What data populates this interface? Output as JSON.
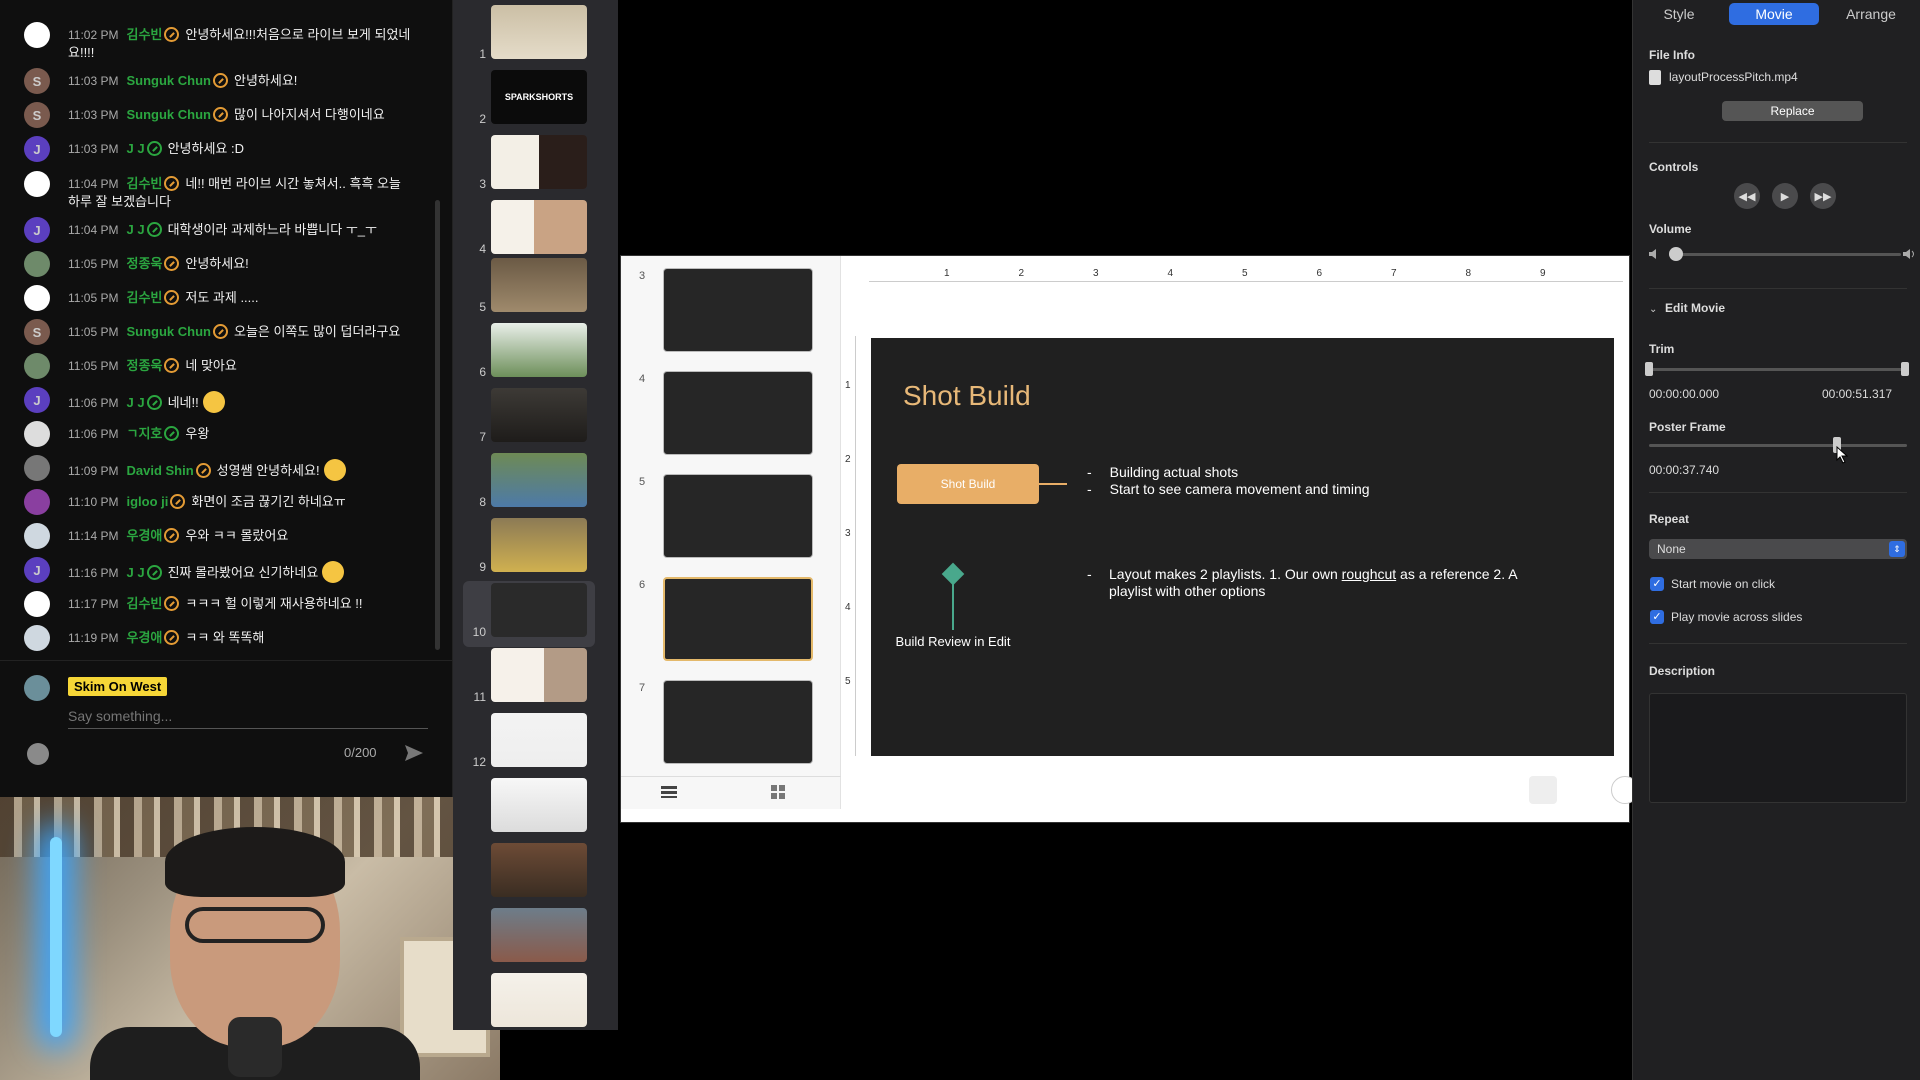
{
  "chat": {
    "messages": [
      {
        "time": "11:02 PM",
        "author": "김수빈",
        "badge": "orange",
        "text": "안녕하세요!!!처음으로 라이브 보게 되었네요!!!!",
        "avatar": "#ffffff",
        "initial": ""
      },
      {
        "time": "11:03 PM",
        "author": "Sunguk Chun",
        "badge": "orange",
        "text": "안녕하세요!",
        "avatar": "#7a5a4e",
        "initial": "S"
      },
      {
        "time": "11:03 PM",
        "author": "Sunguk Chun",
        "badge": "orange",
        "text": "많이 나아지셔서 다행이네요",
        "avatar": "#7a5a4e",
        "initial": "S"
      },
      {
        "time": "11:03 PM",
        "author": "J J",
        "badge": "green",
        "text": "안녕하세요 :D",
        "avatar": "#5b3fbf",
        "initial": "J"
      },
      {
        "time": "11:04 PM",
        "author": "김수빈",
        "badge": "orange",
        "text": "네!! 매번 라이브 시간 놓쳐서.. 흑흑 오늘 하루 잘 보겠습니다",
        "avatar": "#ffffff",
        "initial": ""
      },
      {
        "time": "11:04 PM",
        "author": "J J",
        "badge": "green",
        "text": "대학생이라 과제하느라 바쁩니다 ㅜ_ㅜ",
        "avatar": "#5b3fbf",
        "initial": "J"
      },
      {
        "time": "11:05 PM",
        "author": "정종욱",
        "badge": "orange",
        "text": "안녕하세요!",
        "avatar": "#6e8a6a",
        "initial": ""
      },
      {
        "time": "11:05 PM",
        "author": "김수빈",
        "badge": "orange",
        "text": "저도 과제 .....",
        "avatar": "#ffffff",
        "initial": ""
      },
      {
        "time": "11:05 PM",
        "author": "Sunguk Chun",
        "badge": "orange",
        "text": "오늘은 이쪽도 많이 덥더라구요",
        "avatar": "#7a5a4e",
        "initial": "S"
      },
      {
        "time": "11:05 PM",
        "author": "정종욱",
        "badge": "orange",
        "text": "네 맞아요",
        "avatar": "#6e8a6a",
        "initial": ""
      },
      {
        "time": "11:06 PM",
        "author": "J J",
        "badge": "green",
        "text": "네네!!",
        "avatar": "#5b3fbf",
        "initial": "J",
        "emoji": true
      },
      {
        "time": "11:06 PM",
        "author": "ㄱ지호",
        "badge": "green",
        "text": "우왕",
        "avatar": "#dddddd",
        "initial": ""
      },
      {
        "time": "11:09 PM",
        "author": "David Shin",
        "badge": "orange",
        "text": "성영쌤 안녕하세요!",
        "avatar": "#777777",
        "initial": "",
        "emoji": true
      },
      {
        "time": "11:10 PM",
        "author": "igloo ji",
        "badge": "orange",
        "text": "화면이 조금 끊기긴 하네요ㅠ",
        "avatar": "#8a3fa0",
        "initial": ""
      },
      {
        "time": "11:14 PM",
        "author": "우경애",
        "badge": "orange",
        "text": "우와 ㅋㅋ 몰랐어요",
        "avatar": "#cfd8e0",
        "initial": ""
      },
      {
        "time": "11:16 PM",
        "author": "J J",
        "badge": "green",
        "text": "진짜 몰라봤어요 신기하네요",
        "avatar": "#5b3fbf",
        "initial": "J",
        "emoji": true
      },
      {
        "time": "11:17 PM",
        "author": "김수빈",
        "badge": "orange",
        "text": "ㅋㅋㅋ 헐 이렇게 재사용하네요 !!",
        "avatar": "#ffffff",
        "initial": ""
      },
      {
        "time": "11:19 PM",
        "author": "우경애",
        "badge": "orange",
        "text": "ㅋㅋ 와 똑똑해",
        "avatar": "#cfd8e0",
        "initial": ""
      }
    ],
    "input": {
      "username": "Skim On West",
      "placeholder": "Say something...",
      "char_count": "0/200"
    }
  },
  "navigator": {
    "slide_numbers": [
      "1",
      "2",
      "3",
      "4",
      "5",
      "6",
      "7",
      "8",
      "9",
      "10",
      "11",
      "12"
    ],
    "sparkshorts_label": "SPARKSHORTS"
  },
  "editor": {
    "inner_numbers": [
      "3",
      "4",
      "5",
      "6",
      "7"
    ],
    "ruler_top": [
      "1",
      "2",
      "3",
      "4",
      "5",
      "6",
      "7",
      "8",
      "9"
    ],
    "ruler_left": [
      "1",
      "2",
      "3",
      "4",
      "5"
    ],
    "slide": {
      "title": "Shot Build",
      "box_label": "Shot Build",
      "bullets": [
        "Building actual shots",
        "Start to see camera movement and timing"
      ],
      "bullet2_pre": "Layout makes 2 playlists. 1. Our own ",
      "bullet2_link": "roughcut",
      "bullet2_post": " as a reference 2. A playlist with other options",
      "review_label": "Build Review in Edit",
      "bullet_dash": "-"
    }
  },
  "inspector": {
    "tabs": {
      "style": "Style",
      "movie": "Movie",
      "arrange": "Arrange"
    },
    "file_info_label": "File Info",
    "file_name": "layoutProcessPitch.mp4",
    "replace": "Replace",
    "controls_label": "Controls",
    "volume_label": "Volume",
    "edit_movie_label": "Edit Movie",
    "trim_label": "Trim",
    "trim_start": "00:00:00.000",
    "trim_end": "00:00:51.317",
    "poster_frame_label": "Poster Frame",
    "poster_time": "00:00:37.740",
    "poster_fraction": 0.73,
    "volume_fraction": 0.0,
    "repeat_label": "Repeat",
    "repeat_value": "None",
    "start_on_click": "Start movie on click",
    "play_across": "Play movie across slides",
    "description_label": "Description"
  }
}
